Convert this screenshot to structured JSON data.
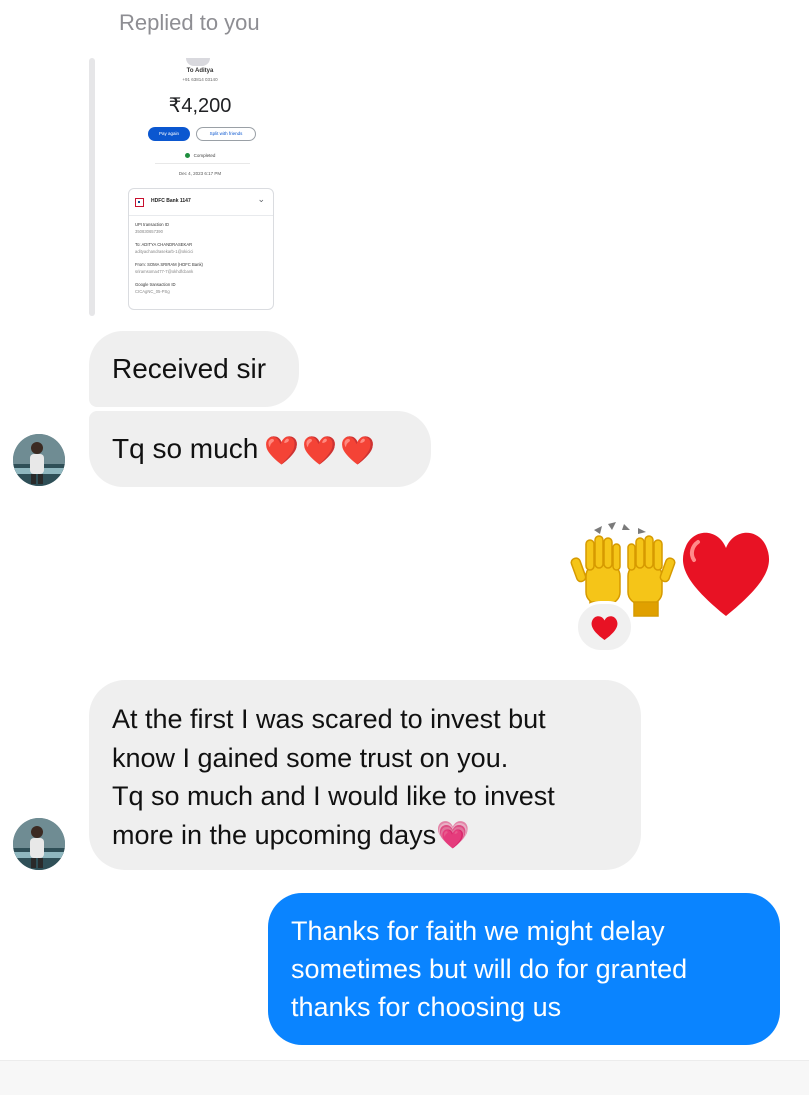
{
  "reply_header": {
    "label": "Replied to you"
  },
  "receipt": {
    "to": "To Aditya",
    "phone": "+91 63814 03140",
    "amount": "₹4,200",
    "pay_again": "Pay again",
    "split": "Split with friends",
    "status": "Completed",
    "date": "Dec 4, 2023 6:17 PM",
    "bank": "HDFC Bank 1147",
    "upi_label": "UPI transaction ID",
    "upi_value": "350830657390",
    "to_label": "To: ADITYA CHANDRASEKAR",
    "to_value": "adityachandrasekarb-1@okicici",
    "from_label": "From: SOMA SRIRAM (HDFC Bank)",
    "from_value": "sriramsoma477-7@okhdfcbank",
    "google_label": "Google transaction ID",
    "google_value": "CICAgNC_05-PSg",
    "status_color": "#1e8e3e"
  },
  "messages": {
    "received": "Received sir",
    "thanks": "Tq so much",
    "thanks_emoji": [
      "❤️",
      "❤️",
      "❤️"
    ],
    "outgoing_emoji": [
      "raised-hands-icon",
      "red-heart-icon"
    ],
    "reaction": "red-heart-icon",
    "long_lines": [
      "At the first I was scared to invest but",
      "know I gained some trust on you.",
      "Tq so much and I would like to invest",
      "more in the upcoming days"
    ],
    "long_emoji": "💗",
    "reply_lines": [
      "Thanks for faith we might delay",
      "sometimes but will do for granted",
      "thanks for choosing us"
    ]
  },
  "colors": {
    "incoming_bubble": "#efefef",
    "outgoing_bubble": "#0a84ff",
    "muted_text": "#8e8e93"
  }
}
